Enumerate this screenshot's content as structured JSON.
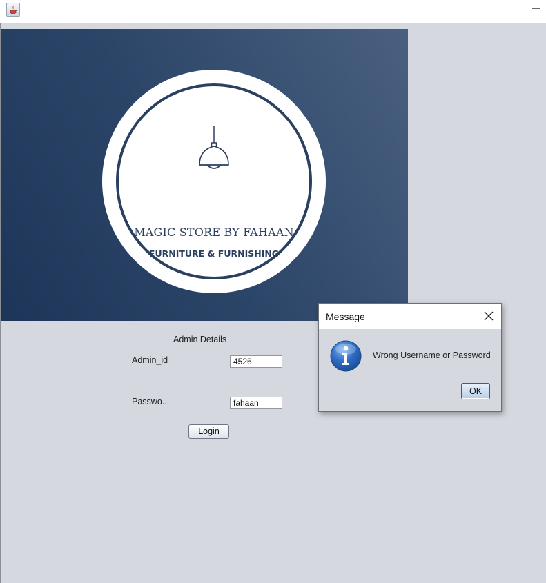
{
  "banner": {
    "store_name": "MAGIC STORE BY FAHAAN",
    "subtitle": "FURNITURE & FURNISHING",
    "icon": "pendant-lamp-icon"
  },
  "form": {
    "heading": "Admin Details",
    "admin_id_label": "Admin_id",
    "admin_id_value": "4526",
    "password_label": "Passwo...",
    "password_value": "fahaan",
    "login_label": "Login"
  },
  "dialog": {
    "title": "Message",
    "message": "Wrong Username or Password",
    "ok_label": "OK",
    "icon": "info-icon"
  },
  "window": {
    "icon": "java-app-icon",
    "controls": [
      "minimize-icon"
    ]
  },
  "colors": {
    "banner_dark": "#1d3558",
    "banner_light": "#4a6080",
    "window_bg": "#d5d8df",
    "logo_navy": "#2a4060"
  }
}
